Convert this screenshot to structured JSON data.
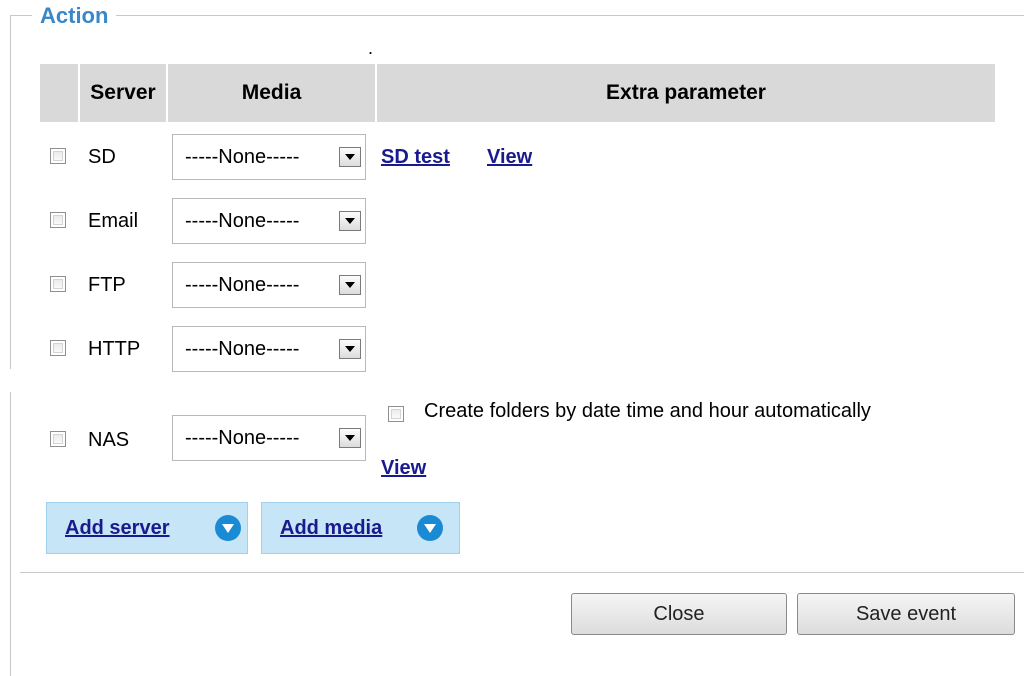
{
  "section": {
    "legend": "Action",
    "dot": "."
  },
  "table": {
    "headers": {
      "server": "Server",
      "media": "Media",
      "extra": "Extra parameter"
    }
  },
  "rows": [
    {
      "server": "SD",
      "media": "-----None-----",
      "links": [
        "SD test",
        "View"
      ]
    },
    {
      "server": "Email",
      "media": "-----None-----"
    },
    {
      "server": "FTP",
      "media": "-----None-----"
    },
    {
      "server": "HTTP",
      "media": "-----None-----"
    },
    {
      "server": "NAS",
      "media": "-----None-----",
      "option": "Create folders by date time and hour automatically",
      "link": "View"
    }
  ],
  "add": {
    "server": "Add server",
    "media": "Add media"
  },
  "buttons": {
    "close": "Close",
    "save": "Save event"
  },
  "colors": {
    "legend": "#3a87c9",
    "header_bg": "#d9d9d9",
    "add_bg": "#c6e5f7",
    "link": "#1a1a8f",
    "circle": "#1a8ad4"
  }
}
